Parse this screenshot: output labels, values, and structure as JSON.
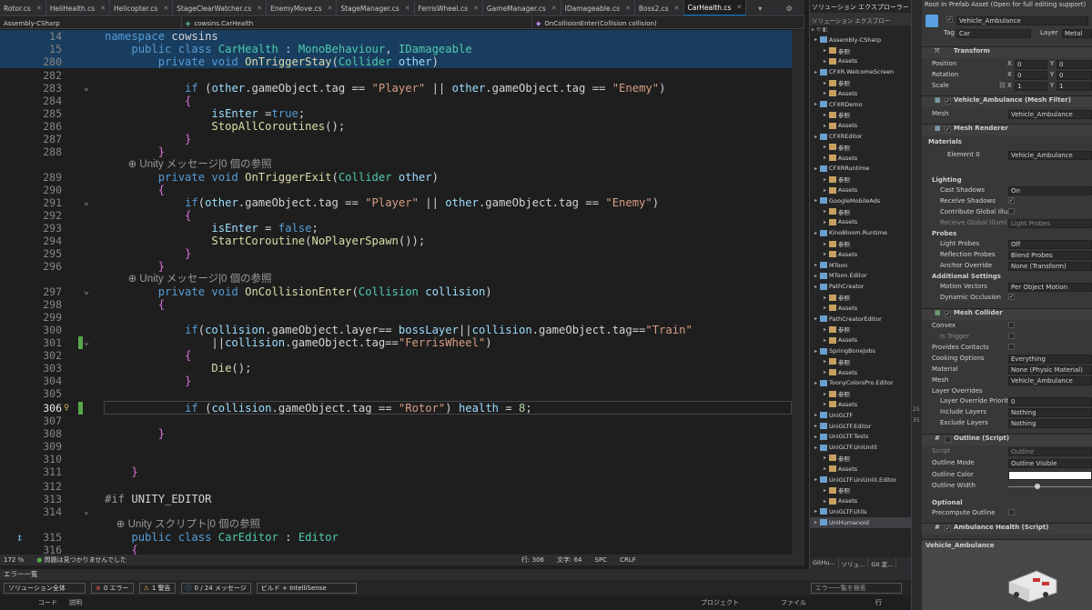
{
  "tabs": [
    {
      "label": "Rotor.cs"
    },
    {
      "label": "HeliHealth.cs"
    },
    {
      "label": "Helicopter.cs"
    },
    {
      "label": "StageClearWatcher.cs"
    },
    {
      "label": "EnemyMove.cs"
    },
    {
      "label": "StageManager.cs"
    },
    {
      "label": "FerrisWheel.cs"
    },
    {
      "label": "GameManager.cs"
    },
    {
      "label": "IDamageable.cs"
    },
    {
      "label": "Boss2.cs"
    },
    {
      "label": "CarHealth.cs"
    }
  ],
  "navbar": {
    "project": "Assembly-CSharp",
    "class": "cowsins.CarHealth",
    "member": "OnCollisionEnter(Collision collision)"
  },
  "code": [
    {
      "ln": "14",
      "text": "namespace cowsins"
    },
    {
      "ln": "15",
      "text": "public class CarHealth : MonoBehaviour, IDamageable"
    },
    {
      "ln": "280",
      "text": "private void OnTriggerStay(Collider other)"
    },
    {
      "ln": "282",
      "text": ""
    },
    {
      "ln": "283",
      "text": "if (other.gameObject.tag == \"Player\" || other.gameObject.tag == \"Enemy\")"
    },
    {
      "ln": "284",
      "text": "{"
    },
    {
      "ln": "285",
      "text": "isEnter =true;"
    },
    {
      "ln": "286",
      "text": "StopAllCoroutines();"
    },
    {
      "ln": "287",
      "text": "}"
    },
    {
      "ln": "288",
      "text": "}"
    },
    {
      "ln": "",
      "text": "Unity メッセージ|0 個の参照"
    },
    {
      "ln": "289",
      "text": "private void OnTriggerExit(Collider other)"
    },
    {
      "ln": "290",
      "text": "{"
    },
    {
      "ln": "291",
      "text": "if(other.gameObject.tag == \"Player\" || other.gameObject.tag == \"Enemy\")"
    },
    {
      "ln": "292",
      "text": "{"
    },
    {
      "ln": "293",
      "text": "isEnter = false;"
    },
    {
      "ln": "294",
      "text": "StartCoroutine(NoPlayerSpawn());"
    },
    {
      "ln": "295",
      "text": "}"
    },
    {
      "ln": "296",
      "text": "}"
    },
    {
      "ln": "",
      "text": "Unity メッセージ|0 個の参照"
    },
    {
      "ln": "297",
      "text": "private void OnCollisionEnter(Collision collision)"
    },
    {
      "ln": "298",
      "text": "{"
    },
    {
      "ln": "299",
      "text": ""
    },
    {
      "ln": "300",
      "text": "if(collision.gameObject.layer== bossLayer||collision.gameObject.tag==\"Train\""
    },
    {
      "ln": "301",
      "text": "||collision.gameObject.tag==\"FerrisWheel\")"
    },
    {
      "ln": "302",
      "text": "{"
    },
    {
      "ln": "303",
      "text": "Die();"
    },
    {
      "ln": "304",
      "text": "}"
    },
    {
      "ln": "305",
      "text": ""
    },
    {
      "ln": "306",
      "text": "if (collision.gameObject.tag == \"Rotor\") health = 8;"
    },
    {
      "ln": "307",
      "text": ""
    },
    {
      "ln": "308",
      "text": "}"
    },
    {
      "ln": "309",
      "text": ""
    },
    {
      "ln": "310",
      "text": ""
    },
    {
      "ln": "311",
      "text": "}"
    },
    {
      "ln": "312",
      "text": ""
    },
    {
      "ln": "313",
      "text": "#if UNITY_EDITOR"
    },
    {
      "ln": "314",
      "text": ""
    },
    {
      "ln": "",
      "text": "Unity スクリプト|0 個の参照"
    },
    {
      "ln": "315",
      "text": "public class CarEditor : Editor"
    },
    {
      "ln": "316",
      "text": "{"
    }
  ],
  "status": {
    "zoom": "172 %",
    "issues": "問題は見つかりませんでした",
    "line": "行: 306",
    "col": "文字: 64",
    "spc": "SPC",
    "crlf": "CRLF"
  },
  "errorlist": {
    "title": "エラー一覧",
    "scope": "ソリューション全体",
    "errors": "0 エラー",
    "warnings": "1 警告",
    "messages": "0 / 24 メッセージ",
    "build": "ビルド + IntelliSense",
    "search_placeholder": "エラー一覧を検索",
    "col_code": "コード",
    "col_desc": "説明",
    "col_project": "プロジェクト",
    "col_file": "ファイル",
    "col_line": "行"
  },
  "solution": {
    "title": "ソリューション エクスプローラー",
    "search": "ソリューション エクスプロー",
    "items": [
      {
        "label": "Assembly-CSharp",
        "level": 0
      },
      {
        "label": "参照",
        "level": 1
      },
      {
        "label": "Assets",
        "level": 1
      },
      {
        "label": "CFXR.WelcomeScreen",
        "level": 0
      },
      {
        "label": "参照",
        "level": 1
      },
      {
        "label": "Assets",
        "level": 1
      },
      {
        "label": "CFXRDemo",
        "level": 0
      },
      {
        "label": "参照",
        "level": 1
      },
      {
        "label": "Assets",
        "level": 1
      },
      {
        "label": "CFXREditor",
        "level": 0
      },
      {
        "label": "参照",
        "level": 1
      },
      {
        "label": "Assets",
        "level": 1
      },
      {
        "label": "CFXRRuntime",
        "level": 0
      },
      {
        "label": "参照",
        "level": 1
      },
      {
        "label": "Assets",
        "level": 1
      },
      {
        "label": "GoogleMobileAds",
        "level": 0
      },
      {
        "label": "参照",
        "level": 1
      },
      {
        "label": "Assets",
        "level": 1
      },
      {
        "label": "KinoBloom.Runtime",
        "level": 0
      },
      {
        "label": "参照",
        "level": 1
      },
      {
        "label": "Assets",
        "level": 1
      },
      {
        "label": "MToon",
        "level": 0
      },
      {
        "label": "MToon.Editor",
        "level": 0
      },
      {
        "label": "PathCreator",
        "level": 0
      },
      {
        "label": "参照",
        "level": 1
      },
      {
        "label": "Assets",
        "level": 1
      },
      {
        "label": "PathCreatorEditor",
        "level": 0
      },
      {
        "label": "参照",
        "level": 1
      },
      {
        "label": "Assets",
        "level": 1
      },
      {
        "label": "SpringBoneJobs",
        "level": 0
      },
      {
        "label": "参照",
        "level": 1
      },
      {
        "label": "Assets",
        "level": 1
      },
      {
        "label": "ToonyColorsPro.Editor",
        "level": 0
      },
      {
        "label": "参照",
        "level": 1
      },
      {
        "label": "Assets",
        "level": 1
      },
      {
        "label": "UniGLTF",
        "level": 0
      },
      {
        "label": "UniGLTF.Editor",
        "level": 0
      },
      {
        "label": "UniGLTF.Tests",
        "level": 0
      },
      {
        "label": "UniGLTF.UniUnlit",
        "level": 0
      },
      {
        "label": "参照",
        "level": 1
      },
      {
        "label": "Assets",
        "level": 1
      },
      {
        "label": "UniGLTF.UniUnlit.Editor",
        "level": 0
      },
      {
        "label": "参照",
        "level": 1
      },
      {
        "label": "Assets",
        "level": 1
      },
      {
        "label": "UniGLTF.Utils",
        "level": 0
      },
      {
        "label": "UniHumanoid",
        "level": 0
      }
    ],
    "tabs": [
      "GitHu...",
      "ソリュ...",
      "Git 変..."
    ]
  },
  "inspector": {
    "header": "Root in Prefab Asset (Open for full editing support)",
    "object_name": "Vehicle_Ambulance",
    "tag_label": "Tag",
    "tag": "Car",
    "layer_label": "Layer",
    "layer": "Metal",
    "transform": {
      "title": "Transform",
      "position": "Position",
      "rotation": "Rotation",
      "scale": "Scale",
      "px": "0",
      "py": "0",
      "rx": "0",
      "ry": "0",
      "sx": "1",
      "sy": "1",
      "x": "X",
      "y": "Y"
    },
    "mesh_filter": {
      "title": "Vehicle_Ambulance (Mesh Filter)",
      "mesh_label": "Mesh",
      "mesh": "Vehicle_Ambulance"
    },
    "mesh_renderer": {
      "title": "Mesh Renderer",
      "materials": "Materials",
      "element": "Element 0",
      "element_val": "Vehicle_Ambulance",
      "lighting": "Lighting",
      "cast": "Cast Shadows",
      "cast_val": "On",
      "receive": "Receive Shadows",
      "contrib": "Contribute Global Illu",
      "receive_gi": "Receive Global Illumi",
      "receive_gi_val": "Light Probes",
      "probes": "Probes",
      "light_probes": "Light Probes",
      "light_probes_val": "Off",
      "refl": "Reflection Probes",
      "refl_val": "Blend Probes",
      "anchor": "Anchor Override",
      "anchor_val": "None (Transform)",
      "additional": "Additional Settings",
      "motion": "Motion Vectors",
      "motion_val": "Per Object Motion",
      "occlusion": "Dynamic Occlusion"
    },
    "mesh_collider": {
      "title": "Mesh Collider",
      "convex": "Convex",
      "trigger": "Is Trigger",
      "contacts": "Provides Contacts",
      "cooking": "Cooking Options",
      "cooking_val": "Everything",
      "material": "Material",
      "material_val": "None (Physic Material)",
      "mesh": "Mesh",
      "mesh_val": "Vehicle_Ambulance",
      "overrides": "Layer Overrides",
      "priority": "Layer Override Priorit",
      "priority_val": "0",
      "include": "Include Layers",
      "include_val": "Nothing",
      "exclude": "Exclude Layers",
      "exclude_val": "Nothing"
    },
    "outline": {
      "title": "Outline (Script)",
      "script": "Script",
      "script_val": "Outline",
      "mode": "Outline Mode",
      "mode_val": "Outline Visible",
      "color": "Outline Color",
      "width": "Outline Width",
      "optional": "Optional",
      "precompute": "Precompute Outline"
    },
    "ambulance_health": {
      "title": "Ambulance Health (Script)"
    },
    "preview_name": "Vehicle_Ambulance"
  },
  "ruler_marks": [
    "25",
    "35"
  ]
}
